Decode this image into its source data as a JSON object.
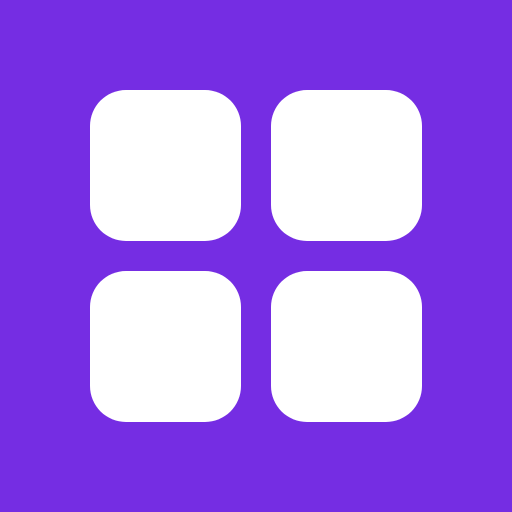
{
  "icon": {
    "name": "grid-icon",
    "background_color": "#752DE3",
    "tile_color": "#FFFFFF",
    "tiles": [
      {
        "name": "tile-top-left"
      },
      {
        "name": "tile-top-right"
      },
      {
        "name": "tile-bottom-left"
      },
      {
        "name": "tile-bottom-right"
      }
    ]
  }
}
